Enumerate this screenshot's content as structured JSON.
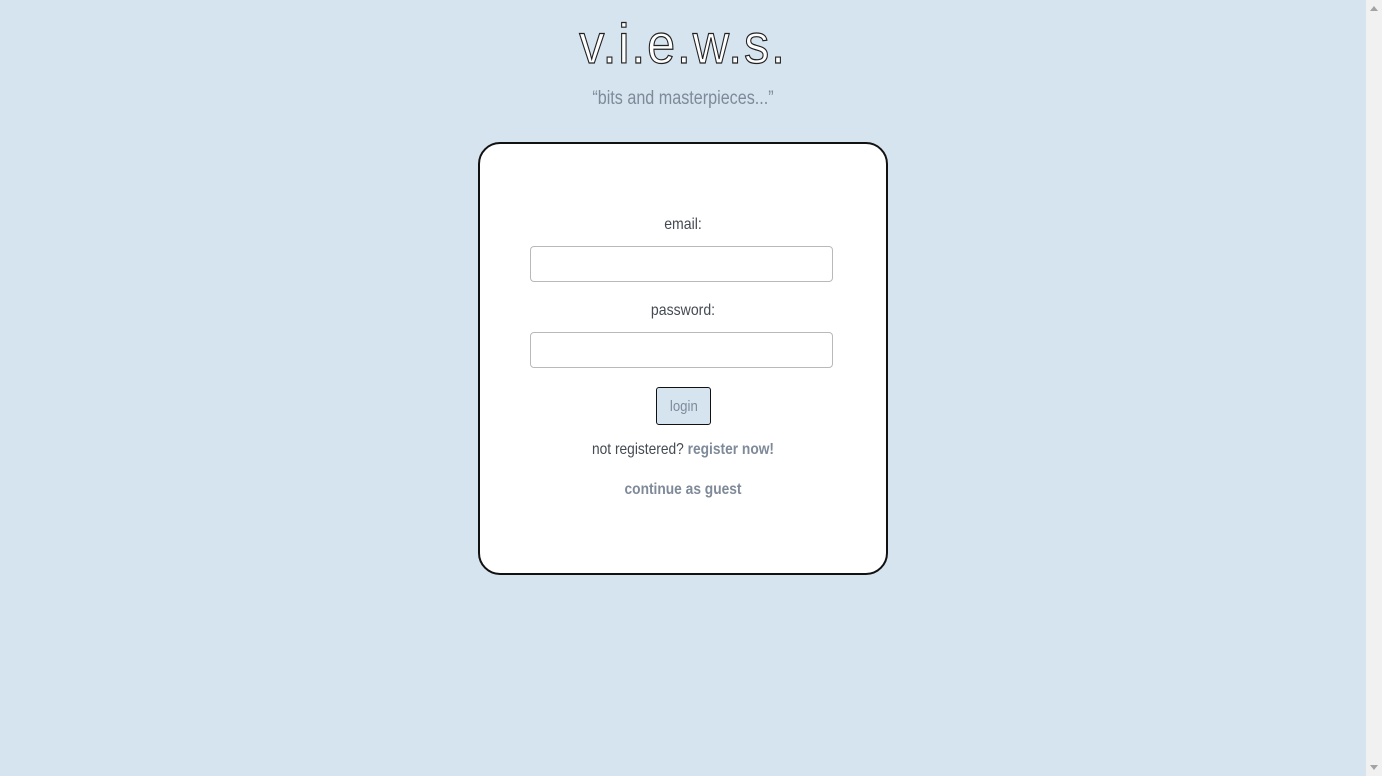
{
  "header": {
    "brand": "v.i.e.w.s.",
    "tagline": "“bits and masterpieces...”"
  },
  "login_form": {
    "email_label": "email:",
    "email_value": "",
    "password_label": "password:",
    "password_value": "",
    "login_label": "login",
    "register_prompt": "not registered?",
    "register_link": "register now!",
    "guest_link": "continue as guest"
  },
  "colors": {
    "background": "#d6e4f0",
    "card": "#ffffff",
    "link": "#7f8a99",
    "text": "#444a52"
  }
}
